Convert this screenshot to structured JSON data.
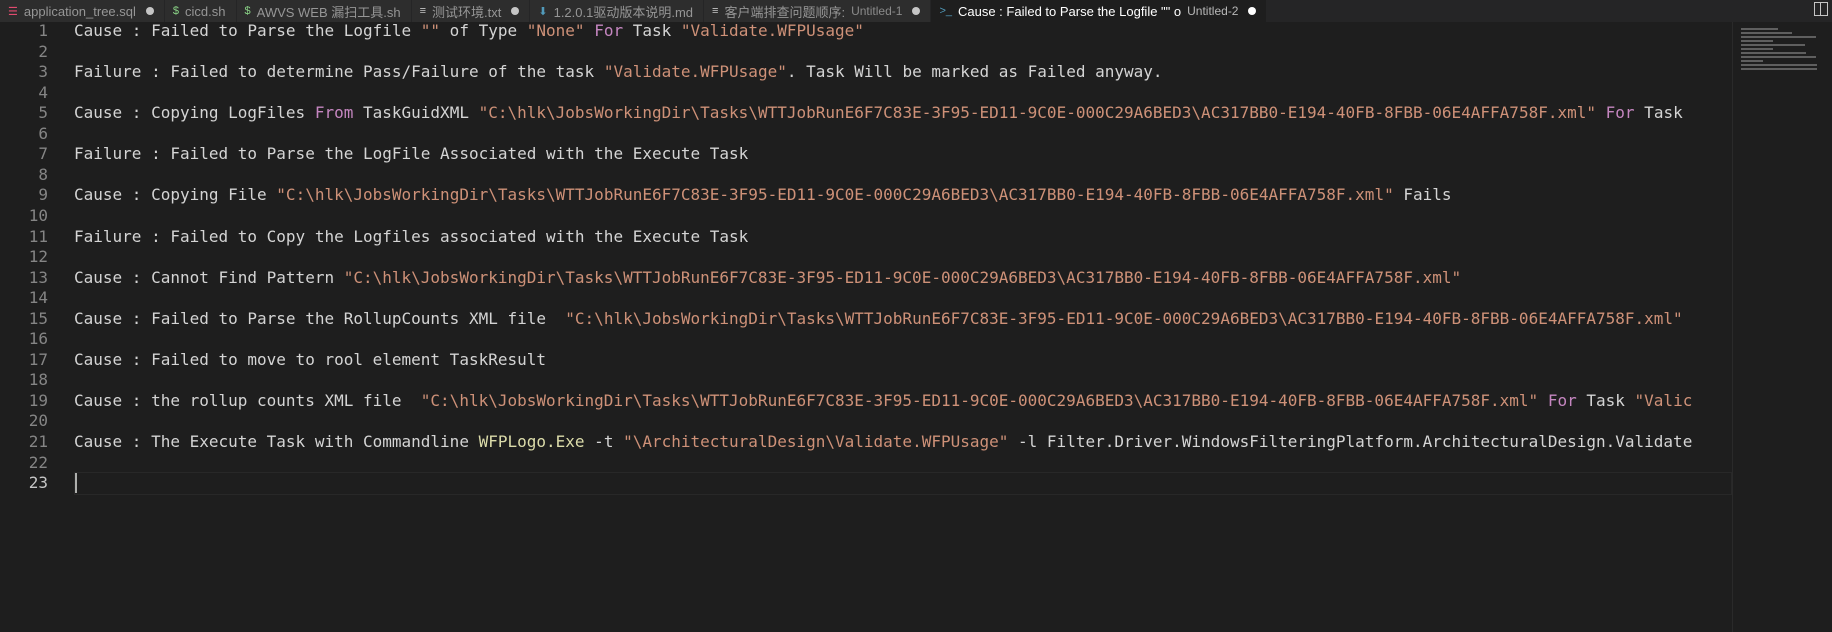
{
  "tabs": [
    {
      "name": "tab-application-tree",
      "icon": "database-icon",
      "icon_glyph": "☰",
      "icon_color": "#e24b6f",
      "label": "application_tree.sql",
      "desc": "",
      "dirty": true,
      "active": false
    },
    {
      "name": "tab-cicd",
      "icon": "terminal-icon",
      "icon_glyph": "$",
      "icon_color": "#89d185",
      "label": "cicd.sh",
      "desc": "",
      "dirty": false,
      "active": false
    },
    {
      "name": "tab-awvs-web",
      "icon": "terminal-icon",
      "icon_glyph": "$",
      "icon_color": "#89d185",
      "label": "AWVS WEB 漏扫工具.sh",
      "desc": "",
      "dirty": false,
      "active": false
    },
    {
      "name": "tab-test-env",
      "icon": "text-file-icon",
      "icon_glyph": "≡",
      "icon_color": "#c5c5c5",
      "label": "测试环境.txt",
      "desc": "",
      "dirty": true,
      "active": false
    },
    {
      "name": "tab-driver-notes",
      "icon": "markdown-icon",
      "icon_glyph": "⬇",
      "icon_color": "#519aba",
      "label": "1.2.0.1驱动版本说明.md",
      "desc": "",
      "dirty": false,
      "active": false
    },
    {
      "name": "tab-untitled-1",
      "icon": "text-file-icon",
      "icon_glyph": "≡",
      "icon_color": "#c5c5c5",
      "label": "客户端排查问题顺序:",
      "desc": "Untitled-1",
      "dirty": true,
      "active": false
    },
    {
      "name": "tab-untitled-2",
      "icon": "chevron-right-icon",
      "icon_glyph": ">_",
      "icon_color": "#519aba",
      "label": "Cause : Failed to Parse the Logfile \"\" o",
      "desc": "Untitled-2",
      "dirty": true,
      "active": true
    }
  ],
  "editor": {
    "current_line": 23,
    "lines": [
      {
        "n": "1",
        "tokens": [
          {
            "t": "Cause : Failed to Parse the Logfile "
          },
          {
            "t": "\"\"",
            "c": "s"
          },
          {
            "t": " of Type "
          },
          {
            "t": "\"None\"",
            "c": "s"
          },
          {
            "t": " "
          },
          {
            "t": "For",
            "c": "k"
          },
          {
            "t": " Task "
          },
          {
            "t": "\"Validate.WFPUsage\"",
            "c": "s"
          }
        ]
      },
      {
        "n": "2",
        "tokens": []
      },
      {
        "n": "3",
        "tokens": [
          {
            "t": "Failure : Failed to determine Pass/Failure of the task "
          },
          {
            "t": "\"Validate.WFPUsage\"",
            "c": "s"
          },
          {
            "t": ". Task Will be marked as Failed anyway."
          }
        ]
      },
      {
        "n": "4",
        "tokens": []
      },
      {
        "n": "5",
        "tokens": [
          {
            "t": "Cause : Copying LogFiles "
          },
          {
            "t": "From",
            "c": "k"
          },
          {
            "t": " TaskGuidXML "
          },
          {
            "t": "\"C:\\hlk\\JobsWorkingDir\\Tasks\\WTTJobRunE6F7C83E-3F95-ED11-9C0E-000C29A6BED3\\AC317BB0-E194-40FB-8FBB-06E4AFFA758F.xml\"",
            "c": "s"
          },
          {
            "t": " "
          },
          {
            "t": "For",
            "c": "k"
          },
          {
            "t": " Task"
          }
        ]
      },
      {
        "n": "6",
        "tokens": []
      },
      {
        "n": "7",
        "tokens": [
          {
            "t": "Failure : Failed to Parse the LogFile Associated with the Execute Task"
          }
        ]
      },
      {
        "n": "8",
        "tokens": []
      },
      {
        "n": "9",
        "tokens": [
          {
            "t": "Cause : Copying File "
          },
          {
            "t": "\"C:\\hlk\\JobsWorkingDir\\Tasks\\WTTJobRunE6F7C83E-3F95-ED11-9C0E-000C29A6BED3\\AC317BB0-E194-40FB-8FBB-06E4AFFA758F.xml\"",
            "c": "s"
          },
          {
            "t": " Fails"
          }
        ]
      },
      {
        "n": "10",
        "tokens": []
      },
      {
        "n": "11",
        "tokens": [
          {
            "t": "Failure : Failed to Copy the Logfiles associated with the Execute Task"
          }
        ]
      },
      {
        "n": "12",
        "tokens": []
      },
      {
        "n": "13",
        "tokens": [
          {
            "t": "Cause : Cannot Find Pattern "
          },
          {
            "t": "\"C:\\hlk\\JobsWorkingDir\\Tasks\\WTTJobRunE6F7C83E-3F95-ED11-9C0E-000C29A6BED3\\AC317BB0-E194-40FB-8FBB-06E4AFFA758F.xml\"",
            "c": "s"
          }
        ]
      },
      {
        "n": "14",
        "tokens": []
      },
      {
        "n": "15",
        "tokens": [
          {
            "t": "Cause : Failed to Parse the RollupCounts XML file  "
          },
          {
            "t": "\"C:\\hlk\\JobsWorkingDir\\Tasks\\WTTJobRunE6F7C83E-3F95-ED11-9C0E-000C29A6BED3\\AC317BB0-E194-40FB-8FBB-06E4AFFA758F.xml\"",
            "c": "s"
          }
        ]
      },
      {
        "n": "16",
        "tokens": []
      },
      {
        "n": "17",
        "tokens": [
          {
            "t": "Cause : Failed to move to rool element TaskResult"
          }
        ]
      },
      {
        "n": "18",
        "tokens": []
      },
      {
        "n": "19",
        "tokens": [
          {
            "t": "Cause : the rollup counts XML file  "
          },
          {
            "t": "\"C:\\hlk\\JobsWorkingDir\\Tasks\\WTTJobRunE6F7C83E-3F95-ED11-9C0E-000C29A6BED3\\AC317BB0-E194-40FB-8FBB-06E4AFFA758F.xml\"",
            "c": "s"
          },
          {
            "t": " "
          },
          {
            "t": "For",
            "c": "k"
          },
          {
            "t": " Task "
          },
          {
            "t": "\"Valic",
            "c": "s"
          }
        ]
      },
      {
        "n": "20",
        "tokens": []
      },
      {
        "n": "21",
        "tokens": [
          {
            "t": "Cause : The Execute Task with Commandline "
          },
          {
            "t": "WFPLogo.Exe",
            "c": "f"
          },
          {
            "t": " -t "
          },
          {
            "t": "\"\\ArchitecturalDesign\\Validate.WFPUsage\"",
            "c": "s"
          },
          {
            "t": " -l Filter.Driver.WindowsFilteringPlatform.ArchitecturalDesign.Validate"
          }
        ]
      },
      {
        "n": "22",
        "tokens": []
      },
      {
        "n": "23",
        "tokens": []
      }
    ]
  }
}
